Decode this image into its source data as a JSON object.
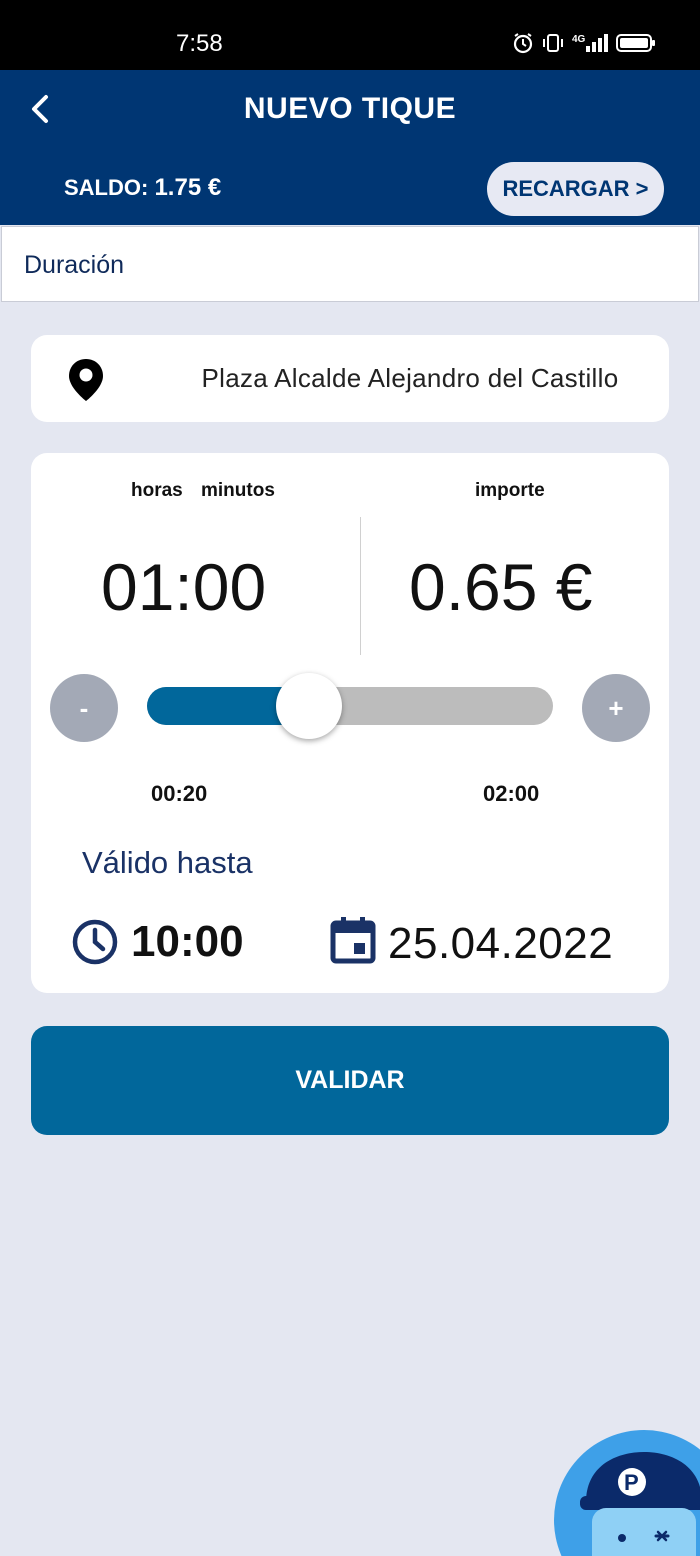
{
  "status_bar": {
    "time": "7:58",
    "network": "4G"
  },
  "header": {
    "title": "NUEVO TIQUE",
    "saldo_label": "SALDO:",
    "saldo_value": "1.75 €",
    "recharge_label": "RECARGAR >"
  },
  "duration_section": {
    "label": "Duración"
  },
  "location": {
    "name": "Plaza Alcalde Alejandro del Castillo"
  },
  "ticket": {
    "hours_label": "horas",
    "minutes_label": "minutos",
    "price_label": "importe",
    "duration_value": "01:00",
    "price_value": "0.65 €",
    "minus_label": "-",
    "plus_label": "+",
    "slider_min": "00:20",
    "slider_max": "02:00",
    "slider_fraction": 0.4,
    "valid_until_label": "Válido hasta",
    "valid_until_time": "10:00",
    "valid_until_date": "25.04.2022"
  },
  "actions": {
    "validate_label": "VALIDAR"
  },
  "colors": {
    "header_bg": "#003673",
    "accent": "#01679b",
    "background": "#e4e7f1",
    "slider_track": "#bcbcbc",
    "round_button": "#a3a9b6"
  }
}
